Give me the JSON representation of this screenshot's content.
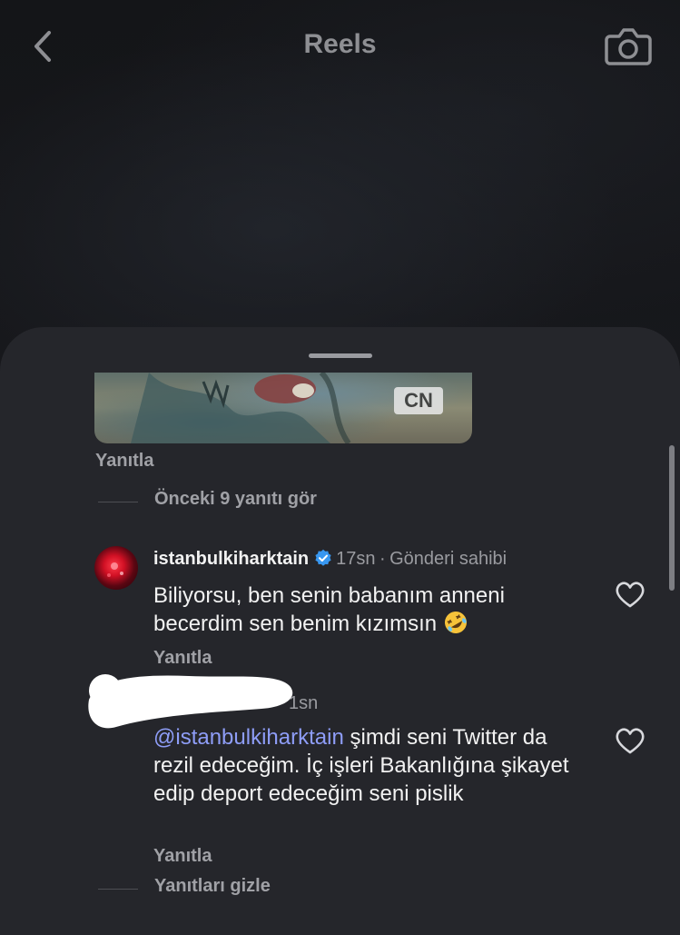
{
  "topbar": {
    "title": "Reels"
  },
  "comments": {
    "reply_label_1": "Yanıtla",
    "view_previous": "Önceki 9 yanıtı gör",
    "owner_comment": {
      "username": "istanbulkiharktain",
      "time": "17sn",
      "badge": "Gönderi sahibi",
      "separator": "·",
      "text": "Biliyorsu, ben senin babanım anneni becerdim sen benim kızımsın",
      "reply_label": "Yanıtla"
    },
    "reply_comment": {
      "time_partial": "1sn",
      "mention": "@istanbulkiharktain",
      "text": " şimdi seni Twitter da rezil edeceğim. İç işleri Bakanlığına şikayet edip deport edeceğim seni pislik",
      "reply_label": "Yanıtla"
    },
    "hide_replies": "Yanıtları gizle"
  },
  "media": {
    "logo_text": "CN"
  },
  "colors": {
    "sheet_bg": "#25262b",
    "mention": "#8e9df7",
    "verified": "#3897f0"
  }
}
